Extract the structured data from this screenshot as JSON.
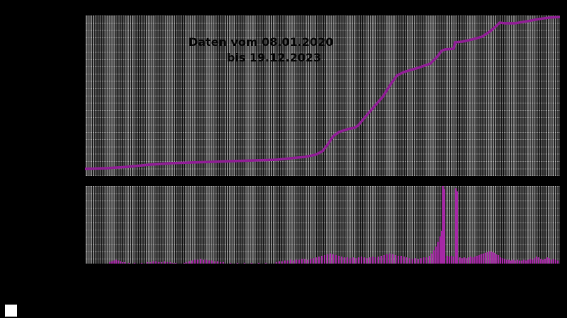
{
  "annotation": {
    "line1": "Daten vom 08.01.2020",
    "line2": "bis 19.12.2023"
  },
  "colors": {
    "background": "#000000",
    "line": "#8f1f94",
    "bars": "#a528a5",
    "band_light": "#757575",
    "band_dark": "#4c4c4c",
    "annotation_text": "#060606",
    "legend_swatch": "#ffffff"
  },
  "chart_data": [
    {
      "type": "line",
      "title": "Daten vom 08.01.2020 bis 19.12.2023",
      "xlabel": "",
      "ylabel": "",
      "x_range": [
        "08.01.2020",
        "19.12.2023"
      ],
      "axis_tick_labels_visible": false,
      "value_scale": "normalized 0-1 (no visible axis labels; values read as fraction of panel height)",
      "grid": {
        "vertical": "weekly dark lines",
        "horizontal": "dashed light lines",
        "background": "alternating monthly gray bands"
      },
      "legend": "none",
      "points_norm": [
        [
          0,
          0.044
        ],
        [
          30,
          0.048
        ],
        [
          60,
          0.057
        ],
        [
          90,
          0.07
        ],
        [
          120,
          0.079
        ],
        [
          150,
          0.084
        ],
        [
          180,
          0.088
        ],
        [
          210,
          0.093
        ],
        [
          240,
          0.097
        ],
        [
          270,
          0.101
        ],
        [
          290,
          0.11
        ],
        [
          310,
          0.119
        ],
        [
          325,
          0.132
        ],
        [
          335,
          0.154
        ],
        [
          342,
          0.194
        ],
        [
          350,
          0.247
        ],
        [
          358,
          0.273
        ],
        [
          370,
          0.291
        ],
        [
          380,
          0.3
        ],
        [
          385,
          0.313
        ],
        [
          400,
          0.392
        ],
        [
          420,
          0.493
        ],
        [
          432,
          0.577
        ],
        [
          440,
          0.626
        ],
        [
          450,
          0.648
        ],
        [
          470,
          0.674
        ],
        [
          487,
          0.7
        ],
        [
          497,
          0.744
        ],
        [
          503,
          0.78
        ],
        [
          508,
          0.789
        ],
        [
          520,
          0.793
        ],
        [
          522,
          0.833
        ],
        [
          532,
          0.837
        ],
        [
          545,
          0.85
        ],
        [
          560,
          0.868
        ],
        [
          572,
          0.903
        ],
        [
          580,
          0.934
        ],
        [
          585,
          0.956
        ],
        [
          592,
          0.952
        ],
        [
          607,
          0.952
        ],
        [
          625,
          0.965
        ],
        [
          640,
          0.978
        ],
        [
          655,
          0.987
        ],
        [
          670,
          0.991
        ]
      ]
    },
    {
      "type": "bar",
      "title": "",
      "xlabel": "",
      "ylabel": "",
      "x_range": [
        "08.01.2020",
        "19.12.2023"
      ],
      "axis_tick_labels_visible": false,
      "value_scale": "normalized 0-1 (no visible axis labels; values read as fraction of panel height)",
      "bars_norm": [
        [
          35,
          0.02
        ],
        [
          38,
          0.03
        ],
        [
          41,
          0.04
        ],
        [
          44,
          0.05
        ],
        [
          47,
          0.04
        ],
        [
          50,
          0.03
        ],
        [
          53,
          0.02
        ],
        [
          56,
          0.02
        ],
        [
          62,
          0.01
        ],
        [
          70,
          0.01
        ],
        [
          80,
          0.01
        ],
        [
          88,
          0.02
        ],
        [
          92,
          0.02
        ],
        [
          96,
          0.03
        ],
        [
          100,
          0.03
        ],
        [
          104,
          0.02
        ],
        [
          108,
          0.02
        ],
        [
          112,
          0.03
        ],
        [
          116,
          0.02
        ],
        [
          120,
          0.02
        ],
        [
          124,
          0.01
        ],
        [
          128,
          0.01
        ],
        [
          140,
          0.01
        ],
        [
          150,
          0.01
        ],
        [
          143,
          0.02
        ],
        [
          147,
          0.03
        ],
        [
          151,
          0.04
        ],
        [
          155,
          0.05
        ],
        [
          159,
          0.05
        ],
        [
          163,
          0.06
        ],
        [
          167,
          0.05
        ],
        [
          171,
          0.05
        ],
        [
          175,
          0.04
        ],
        [
          179,
          0.04
        ],
        [
          183,
          0.03
        ],
        [
          187,
          0.03
        ],
        [
          191,
          0.02
        ],
        [
          195,
          0.02
        ],
        [
          205,
          0.01
        ],
        [
          215,
          0.01
        ],
        [
          225,
          0.01
        ],
        [
          235,
          0.01
        ],
        [
          245,
          0.01
        ],
        [
          255,
          0.01
        ],
        [
          270,
          0.02
        ],
        [
          274,
          0.03
        ],
        [
          278,
          0.03
        ],
        [
          282,
          0.04
        ],
        [
          286,
          0.04
        ],
        [
          290,
          0.05
        ],
        [
          294,
          0.04
        ],
        [
          298,
          0.05
        ],
        [
          302,
          0.05
        ],
        [
          306,
          0.06
        ],
        [
          310,
          0.06
        ],
        [
          314,
          0.05
        ],
        [
          318,
          0.06
        ],
        [
          322,
          0.07
        ],
        [
          326,
          0.08
        ],
        [
          330,
          0.09
        ],
        [
          334,
          0.1
        ],
        [
          338,
          0.11
        ],
        [
          342,
          0.12
        ],
        [
          346,
          0.13
        ],
        [
          350,
          0.12
        ],
        [
          354,
          0.11
        ],
        [
          358,
          0.1
        ],
        [
          362,
          0.09
        ],
        [
          366,
          0.08
        ],
        [
          370,
          0.08
        ],
        [
          374,
          0.07
        ],
        [
          378,
          0.08
        ],
        [
          382,
          0.07
        ],
        [
          386,
          0.08
        ],
        [
          390,
          0.09
        ],
        [
          394,
          0.08
        ],
        [
          398,
          0.07
        ],
        [
          402,
          0.08
        ],
        [
          406,
          0.09
        ],
        [
          410,
          0.08
        ],
        [
          414,
          0.09
        ],
        [
          418,
          0.1
        ],
        [
          422,
          0.11
        ],
        [
          426,
          0.12
        ],
        [
          430,
          0.13
        ],
        [
          434,
          0.12
        ],
        [
          438,
          0.11
        ],
        [
          442,
          0.1
        ],
        [
          446,
          0.1
        ],
        [
          450,
          0.09
        ],
        [
          454,
          0.08
        ],
        [
          458,
          0.07
        ],
        [
          462,
          0.06
        ],
        [
          466,
          0.07
        ],
        [
          470,
          0.06
        ],
        [
          474,
          0.07
        ],
        [
          478,
          0.08
        ],
        [
          482,
          0.08
        ],
        [
          486,
          0.1
        ],
        [
          489,
          0.13
        ],
        [
          492,
          0.17
        ],
        [
          495,
          0.22
        ],
        [
          498,
          0.28
        ],
        [
          501,
          0.35
        ],
        [
          503,
          0.42
        ],
        [
          505,
          1.0
        ],
        [
          507,
          0.96
        ],
        [
          511,
          0.1
        ],
        [
          514,
          0.09
        ],
        [
          517,
          0.1
        ],
        [
          520,
          0.09
        ],
        [
          523,
          0.97
        ],
        [
          525,
          0.93
        ],
        [
          529,
          0.08
        ],
        [
          532,
          0.07
        ],
        [
          535,
          0.08
        ],
        [
          538,
          0.07
        ],
        [
          541,
          0.08
        ],
        [
          544,
          0.09
        ],
        [
          547,
          0.08
        ],
        [
          550,
          0.09
        ],
        [
          553,
          0.1
        ],
        [
          556,
          0.11
        ],
        [
          559,
          0.12
        ],
        [
          562,
          0.13
        ],
        [
          565,
          0.14
        ],
        [
          568,
          0.15
        ],
        [
          571,
          0.16
        ],
        [
          574,
          0.15
        ],
        [
          577,
          0.14
        ],
        [
          580,
          0.12
        ],
        [
          583,
          0.11
        ],
        [
          586,
          0.08
        ],
        [
          589,
          0.07
        ],
        [
          592,
          0.06
        ],
        [
          595,
          0.05
        ],
        [
          598,
          0.05
        ],
        [
          601,
          0.04
        ],
        [
          604,
          0.05
        ],
        [
          607,
          0.04
        ],
        [
          610,
          0.05
        ],
        [
          613,
          0.04
        ],
        [
          616,
          0.04
        ],
        [
          619,
          0.05
        ],
        [
          622,
          0.04
        ],
        [
          625,
          0.05
        ],
        [
          628,
          0.06
        ],
        [
          631,
          0.05
        ],
        [
          634,
          0.07
        ],
        [
          637,
          0.09
        ],
        [
          640,
          0.08
        ],
        [
          643,
          0.06
        ],
        [
          646,
          0.05
        ],
        [
          649,
          0.06
        ],
        [
          652,
          0.08
        ],
        [
          655,
          0.07
        ],
        [
          658,
          0.05
        ],
        [
          661,
          0.06
        ],
        [
          664,
          0.05
        ],
        [
          667,
          0.04
        ]
      ]
    }
  ]
}
